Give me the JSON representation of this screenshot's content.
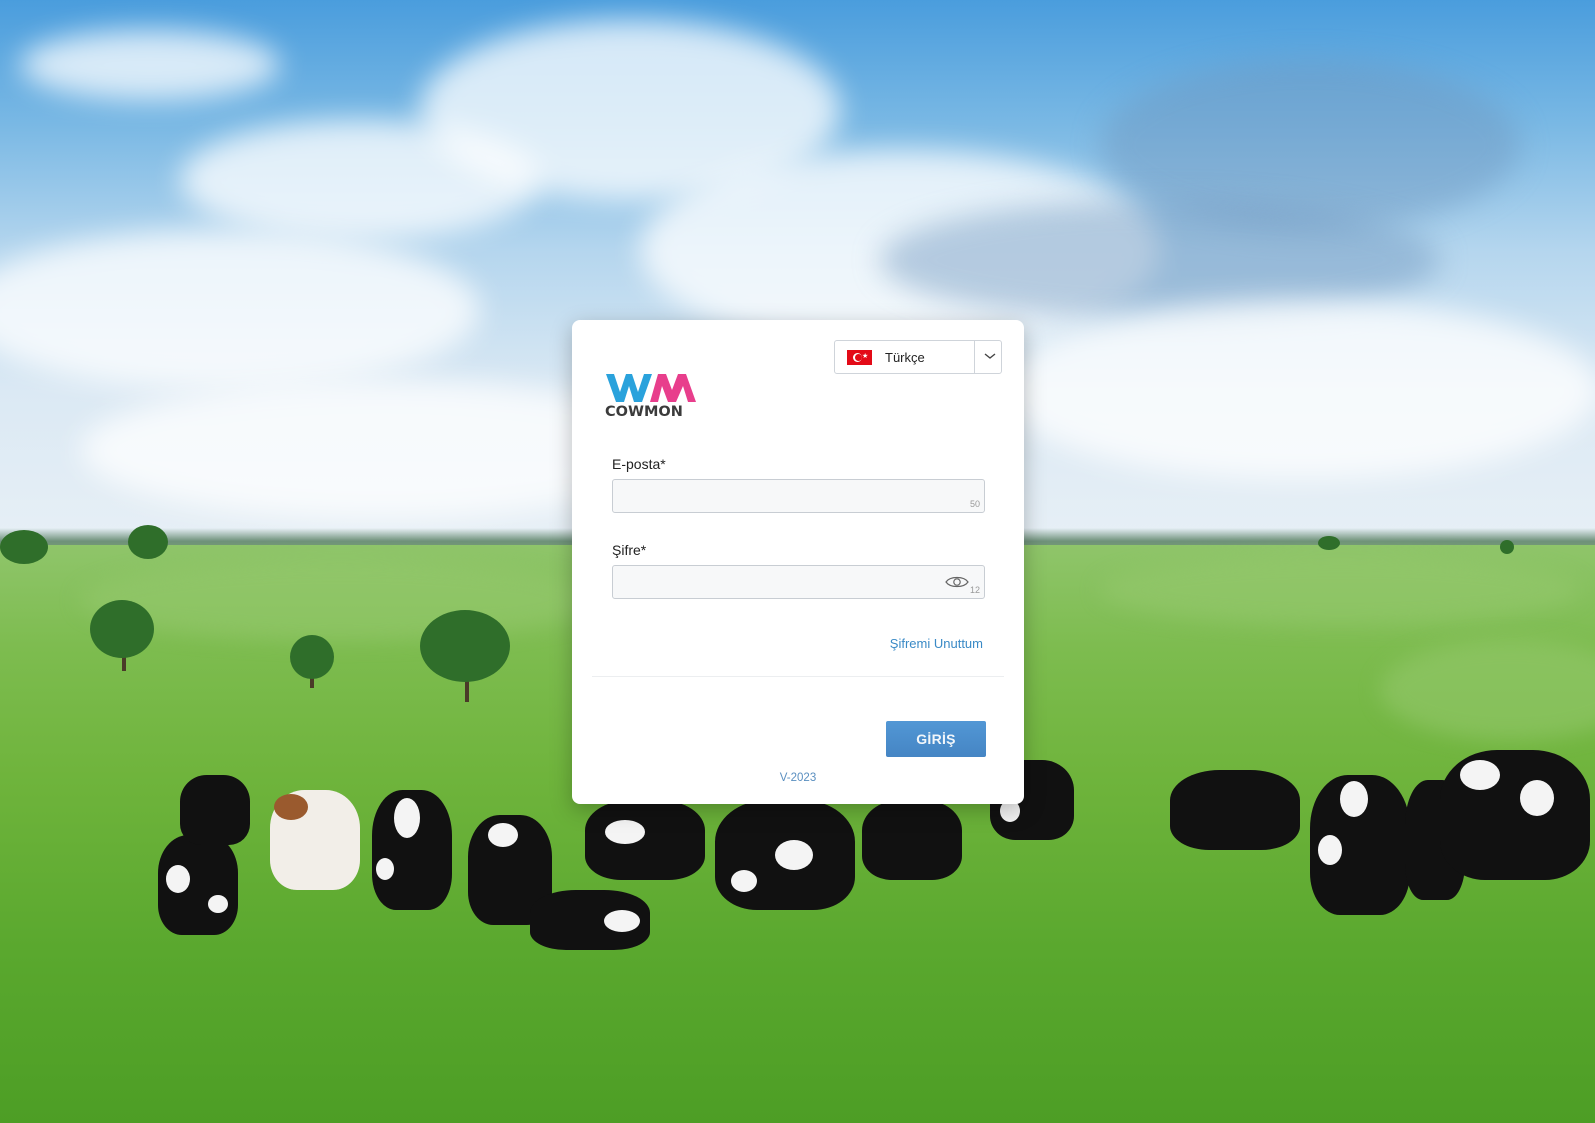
{
  "background": {
    "scene": "cows-in-pasture"
  },
  "language": {
    "selected": "Türkçe",
    "flag_icon": "turkey-flag-icon",
    "chevron_icon": "chevron-down-icon"
  },
  "brand": {
    "mark": "WM",
    "wordmark": "COWMON",
    "colors": {
      "w": "#2aa2dc",
      "m": "#e83e8c",
      "text": "#3b3b3b"
    }
  },
  "form": {
    "email_label": "E-posta*",
    "email_value": "",
    "email_counter": "50",
    "password_label": "Şifre*",
    "password_value": "",
    "password_counter": "12",
    "show_password_icon": "eye-icon",
    "forgot_password": "Şifremi Unuttum",
    "submit_label": "GİRİŞ"
  },
  "footer": {
    "version": "V-2023"
  },
  "colors": {
    "button": "#4a90d9",
    "link": "#3a8ac6"
  }
}
